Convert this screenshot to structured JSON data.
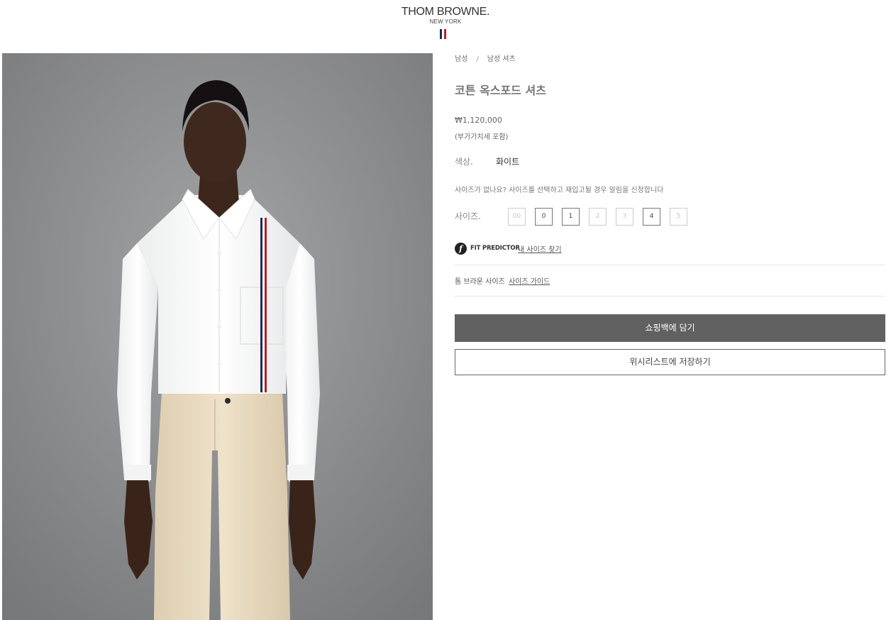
{
  "header": {
    "brand": "THOM BROWNE.",
    "city": "NEW YORK",
    "flag_colors": [
      "#1f2a5c",
      "#ffffff",
      "#b3202c"
    ]
  },
  "product_image": {
    "background_color": "#8d8e90",
    "shirt_color": "#ffffff",
    "trouser_color": "#e8d9bf",
    "stripe_colors": [
      "#1f2a5c",
      "#ffffff",
      "#b3202c"
    ]
  },
  "breadcrumb": {
    "items": [
      "남성",
      "남성 셔츠"
    ],
    "separator": "/"
  },
  "product": {
    "title": "코튼 옥스포드 셔츠",
    "price": "₩1,120,000",
    "vat_note": "(부가가치세 포함)",
    "color_label": "색상.",
    "color_value": "화이트"
  },
  "size_notice": "사이즈가 없나요? 사이즈를 선택하고 재입고될 경우 알림을 신청합니다",
  "sizes": {
    "label": "사이즈.",
    "options": [
      {
        "label": "00",
        "available": false
      },
      {
        "label": "0",
        "available": true
      },
      {
        "label": "1",
        "available": true
      },
      {
        "label": "2",
        "available": false
      },
      {
        "label": "3",
        "available": false
      },
      {
        "label": "4",
        "available": true
      },
      {
        "label": "5",
        "available": false
      }
    ]
  },
  "fit_predictor": {
    "icon": "f",
    "name": "FIT PREDICTOR",
    "link": "내 사이즈 찾기"
  },
  "size_guide": {
    "text": "톰 브라운 사이즈",
    "link": "사이즈 가이드"
  },
  "actions": {
    "add_to_bag": "쇼핑백에 담기",
    "save_wishlist": "위시리스트에 저장하기"
  }
}
